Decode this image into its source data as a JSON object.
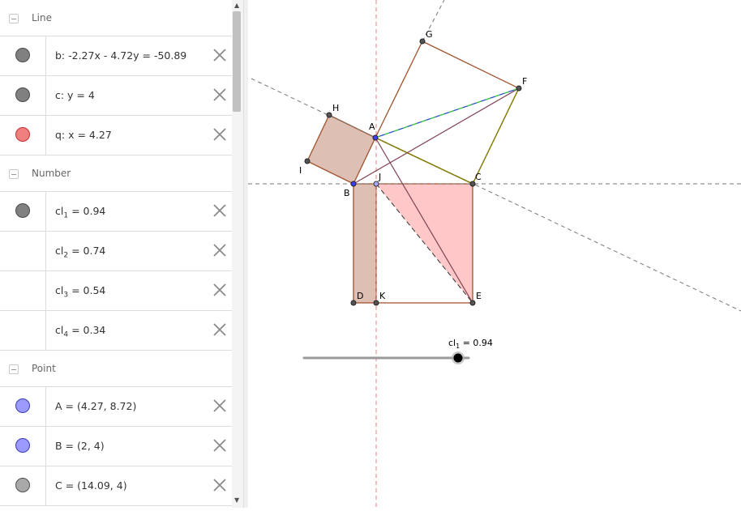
{
  "algebra": {
    "groups": [
      {
        "label": "Line",
        "rows": [
          {
            "expr": "b: -2.27x - 4.72y = -50.89",
            "marble": "#808080"
          },
          {
            "expr": "c: y = 4",
            "marble": "#808080"
          },
          {
            "expr": "q: x = 4.27",
            "marble": "#f08080"
          }
        ]
      },
      {
        "label": "Number",
        "rows": [
          {
            "name": "cl",
            "sub": "1",
            "value": " = 0.94",
            "marble": "#808080"
          },
          {
            "name": "cl",
            "sub": "2",
            "value": " = 0.74",
            "marble": null
          },
          {
            "name": "cl",
            "sub": "3",
            "value": " = 0.54",
            "marble": null
          },
          {
            "name": "cl",
            "sub": "4",
            "value": " = 0.34",
            "marble": null
          }
        ]
      },
      {
        "label": "Point",
        "rows": [
          {
            "expr": "A = (4.27, 8.72)",
            "marble": "#9a9aff"
          },
          {
            "expr": "B = (2, 4)",
            "marble": "#9a9aff"
          },
          {
            "expr": "C = (14.09, 4)",
            "marble": "#a8a8a8"
          }
        ]
      }
    ]
  },
  "graphics": {
    "point_labels": {
      "A": "A",
      "B": "B",
      "C": "C",
      "D": "D",
      "E": "E",
      "F": "F",
      "G": "G",
      "H": "H",
      "I": "I",
      "J": "J",
      "K": "K"
    },
    "slider": {
      "name": "cl",
      "sub": "1",
      "value": " = 0.94"
    }
  }
}
